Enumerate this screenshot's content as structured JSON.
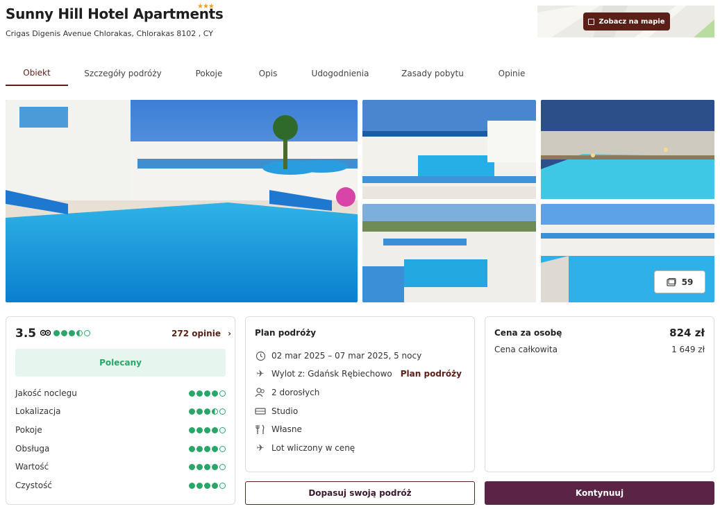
{
  "hotel": {
    "name": "Sunny Hill Hotel Apartments",
    "stars": "★★★",
    "address": "Crigas Digenis Avenue Chlorakas, Chlorakas 8102 , CY",
    "map_button": "Zobacz na mapie"
  },
  "tabs": [
    "Obiekt",
    "Szczegóły podróży",
    "Pokoje",
    "Opis",
    "Udogodnienia",
    "Zasady pobytu",
    "Opinie"
  ],
  "gallery": {
    "photo_count": "59"
  },
  "rating": {
    "score": "3.5",
    "tripadvisor_bubbles": 3.5,
    "reviews_link": "272 opinie",
    "badge": "Polecany",
    "categories": [
      {
        "label": "Jakość noclegu",
        "value": 4
      },
      {
        "label": "Lokalizacja",
        "value": 3.5
      },
      {
        "label": "Pokoje",
        "value": 4
      },
      {
        "label": "Obsługa",
        "value": 4
      },
      {
        "label": "Wartość",
        "value": 4
      },
      {
        "label": "Czystość",
        "value": 4
      }
    ]
  },
  "plan": {
    "title": "Plan podróży",
    "dates": "02 mar 2025 – 07 mar 2025, 5 nocy",
    "flight_from": "Wylot z: Gdańsk Rębiechowo",
    "flight_link": "Plan podróży",
    "guests": "2 dorosłych",
    "room": "Studio",
    "board": "Własne",
    "flight_included": "Lot wliczony w cenę"
  },
  "price": {
    "per_person_label": "Cena za osobę",
    "per_person_value": "824 zł",
    "total_label": "Cena całkowita",
    "total_value": "1 649 zł"
  },
  "buttons": {
    "customize": "Dopasuj swoją podróż",
    "continue": "Kontynuuj"
  },
  "colors": {
    "brand": "#5a1f16",
    "primary_button": "#5b2447",
    "rating_green": "#2aa66a",
    "stars": "#f0a020"
  }
}
